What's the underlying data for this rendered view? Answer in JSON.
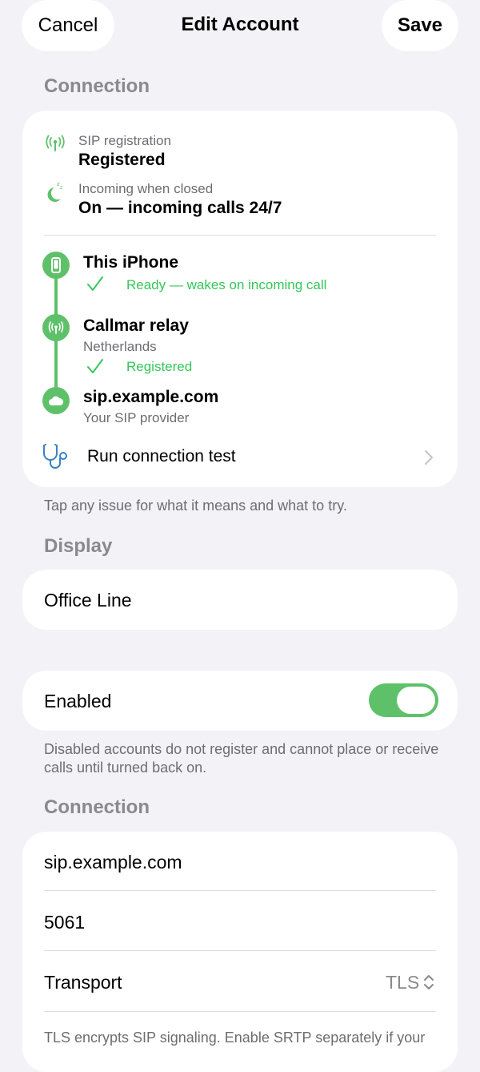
{
  "nav": {
    "cancel": "Cancel",
    "title": "Edit Account",
    "save": "Save"
  },
  "connection_status": {
    "header": "Connection",
    "sip_registration": {
      "label": "SIP registration",
      "value": "Registered",
      "icon": "antenna-icon"
    },
    "incoming": {
      "label": "Incoming when closed",
      "value": "On — incoming calls 24/7",
      "icon": "moon-zzz-icon"
    },
    "path": [
      {
        "title": "This iPhone",
        "subtitle": "",
        "status": "Ready — wakes on incoming call",
        "icon": "phone-icon"
      },
      {
        "title": "Callmar relay",
        "subtitle": "Netherlands",
        "status": "Registered",
        "icon": "antenna-icon"
      },
      {
        "title": "sip.example.com",
        "subtitle": "Your SIP provider",
        "status": "",
        "icon": "cloud-icon"
      }
    ],
    "test_label": "Run connection test",
    "footnote": "Tap any issue for what it means and what to try."
  },
  "display": {
    "header": "Display",
    "name_value": "Office Line"
  },
  "enabled": {
    "label": "Enabled",
    "on": true,
    "footnote": "Disabled accounts do not register and cannot place or receive calls until turned back on."
  },
  "connection": {
    "header": "Connection",
    "server_value": "sip.example.com",
    "port_value": "5061",
    "transport_label": "Transport",
    "transport_value": "TLS",
    "footnote": "TLS encrypts SIP signaling. Enable SRTP separately if your"
  },
  "colors": {
    "accent_green": "#34c759",
    "path_green": "#5ec16a",
    "blue": "#3a82c4"
  }
}
